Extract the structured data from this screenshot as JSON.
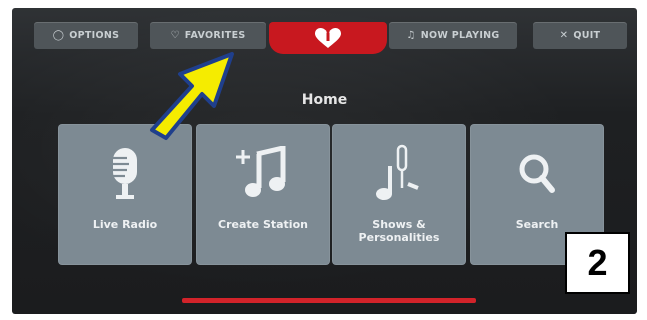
{
  "topbar": {
    "options_label": "OPTIONS",
    "favorites_label": "FAVORITES",
    "now_playing_label": "NOW PLAYING",
    "quit_label": "QUIT",
    "options_icon": "radio-circle-icon",
    "favorites_icon": "heart-icon",
    "now_playing_icon": "music-note-icon",
    "quit_icon": "x-icon",
    "brand_logo": "iheart-logo"
  },
  "home": {
    "title": "Home"
  },
  "tiles": [
    {
      "label": "Live Radio",
      "icon": "microphone-icon"
    },
    {
      "label": "Create Station",
      "icon": "add-music-icon"
    },
    {
      "label": "Shows &\nPersonalities",
      "icon": "shows-icon"
    },
    {
      "label": "Search",
      "icon": "search-icon"
    }
  ],
  "annotation": {
    "step": "2"
  },
  "colors": {
    "brand_red": "#c8181f",
    "tile": "#7d8a93",
    "button": "#4f5559",
    "arrow": "#f5ec00",
    "arrow_outline": "#1f3f8c"
  }
}
